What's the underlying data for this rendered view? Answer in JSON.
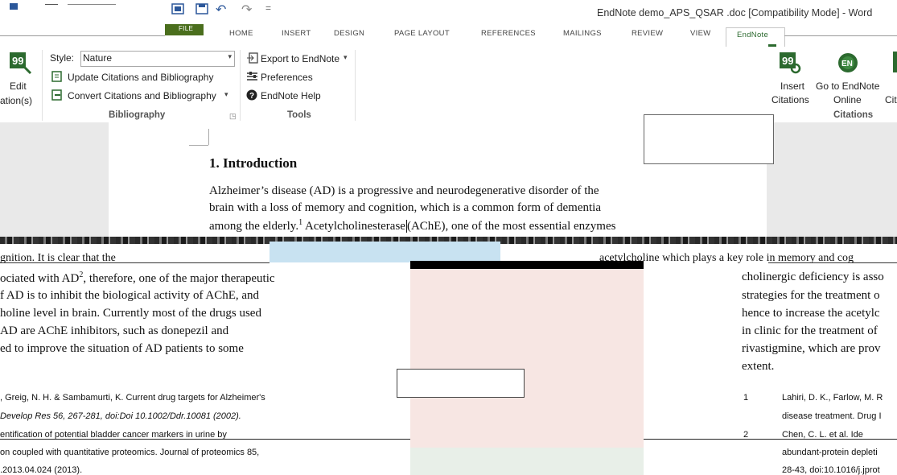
{
  "window": {
    "title": "EndNote demo_APS_QSAR .doc [Compatibility Mode] - Word",
    "qat_undo": "↶",
    "qat_redo": "↷",
    "qat_more": "="
  },
  "tabs": [
    {
      "label": "FILE"
    },
    {
      "label": "HOME"
    },
    {
      "label": "INSERT"
    },
    {
      "label": "DESIGN"
    },
    {
      "label": "PAGE LAYOUT"
    },
    {
      "label": "REFERENCES"
    },
    {
      "label": "MAILINGS"
    },
    {
      "label": "REVIEW"
    },
    {
      "label": "VIEW"
    },
    {
      "label": "EndNote"
    }
  ],
  "ribbon": {
    "edit_citations_label_1": "Edit",
    "edit_citations_label_2": "ation(s)",
    "style_label": "Style:",
    "style_value": "Nature",
    "update_label": "Update Citations and Bibliography",
    "convert_label": "Convert Citations and Bibliography",
    "bibliography_group": "Bibliography",
    "export_label": "Export to EndNote",
    "preferences_label": "Preferences",
    "help_label": "EndNote Help",
    "tools_group": "Tools",
    "insert_citations_1": "Insert",
    "insert_citations_2": "Citations",
    "goto_online_1": "Go to EndNote",
    "goto_online_2": "Online",
    "cite_cut": "Cit",
    "citations_group": "Citations"
  },
  "document": {
    "heading": "1. Introduction",
    "para_line1": "Alzheimer’s disease (AD) is a progressive and neurodegenerative disorder of the",
    "para_line2": "brain with a loss of memory and cognition, which is a common form of dementia",
    "para_line3a": "among the elderly.",
    "para_line3_sup": "1",
    "para_line3b": " Acetylcholinesterase",
    "para_line3c": "(AChE), one of the most essential enzymes",
    "lower_left_top": "gnition. It is clear that the",
    "lower_left": [
      "ociated with AD",
      "f AD is to inhibit the biological activity of AChE, and",
      "holine level in brain.    Currently most of the drugs used",
      "AD are AChE inhibitors, such as donepezil and",
      "ed to improve the situation of AD patients to some"
    ],
    "lower_left_sup": "2",
    "lower_left_after_sup": ", therefore, one of the major therapeutic",
    "lower_right_top": "acetylcholine which plays a key role in memory and cog",
    "lower_right": [
      "cholinergic deficiency is asso",
      "strategies for the treatment o",
      "hence to increase the acetylc",
      "in clinic for the treatment of",
      "rivastigmine, which are prov",
      "extent."
    ],
    "refs_left": [
      ", Greig, N. H. & Sambamurti, K. Current drug targets for Alzheimer's",
      "Develop Res 56, 267-281, doi:Doi 10.1002/Ddr.10081 (2002).",
      "entification   of   potential   bladder   cancer   markers   in   urine   by",
      "on coupled with quantitative proteomics. Journal of proteomics 85,",
      ".2013.04.024 (2013)."
    ],
    "refs_right_num": [
      "1",
      "2"
    ],
    "refs_right": [
      "Lahiri, D. K., Farlow, M. R",
      "disease treatment. Drug I",
      "Chen,  C.  L.  et  al.  Ide",
      "abundant-protein depleti",
      "28-43, doi:10.1016/j.jprot"
    ]
  },
  "colors": {
    "word_blue": "#2b579a",
    "endnote_green": "#2c6a2f",
    "file_tab": "#4a6e1d"
  }
}
